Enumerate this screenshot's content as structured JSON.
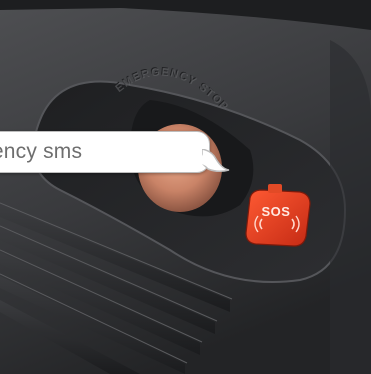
{
  "scene": {
    "panel_inscription": "EMERGENCY STOP",
    "button_label": "SOS"
  },
  "chat_bubble": {
    "text": "gency sms"
  },
  "colors": {
    "panel": "#3a3b3e",
    "sos_red": "#e53a1f",
    "bubble_bg": "#ffffff",
    "bubble_text": "#6e6e6e"
  },
  "icons": {
    "sos_waves": "signal-waves-icon"
  }
}
